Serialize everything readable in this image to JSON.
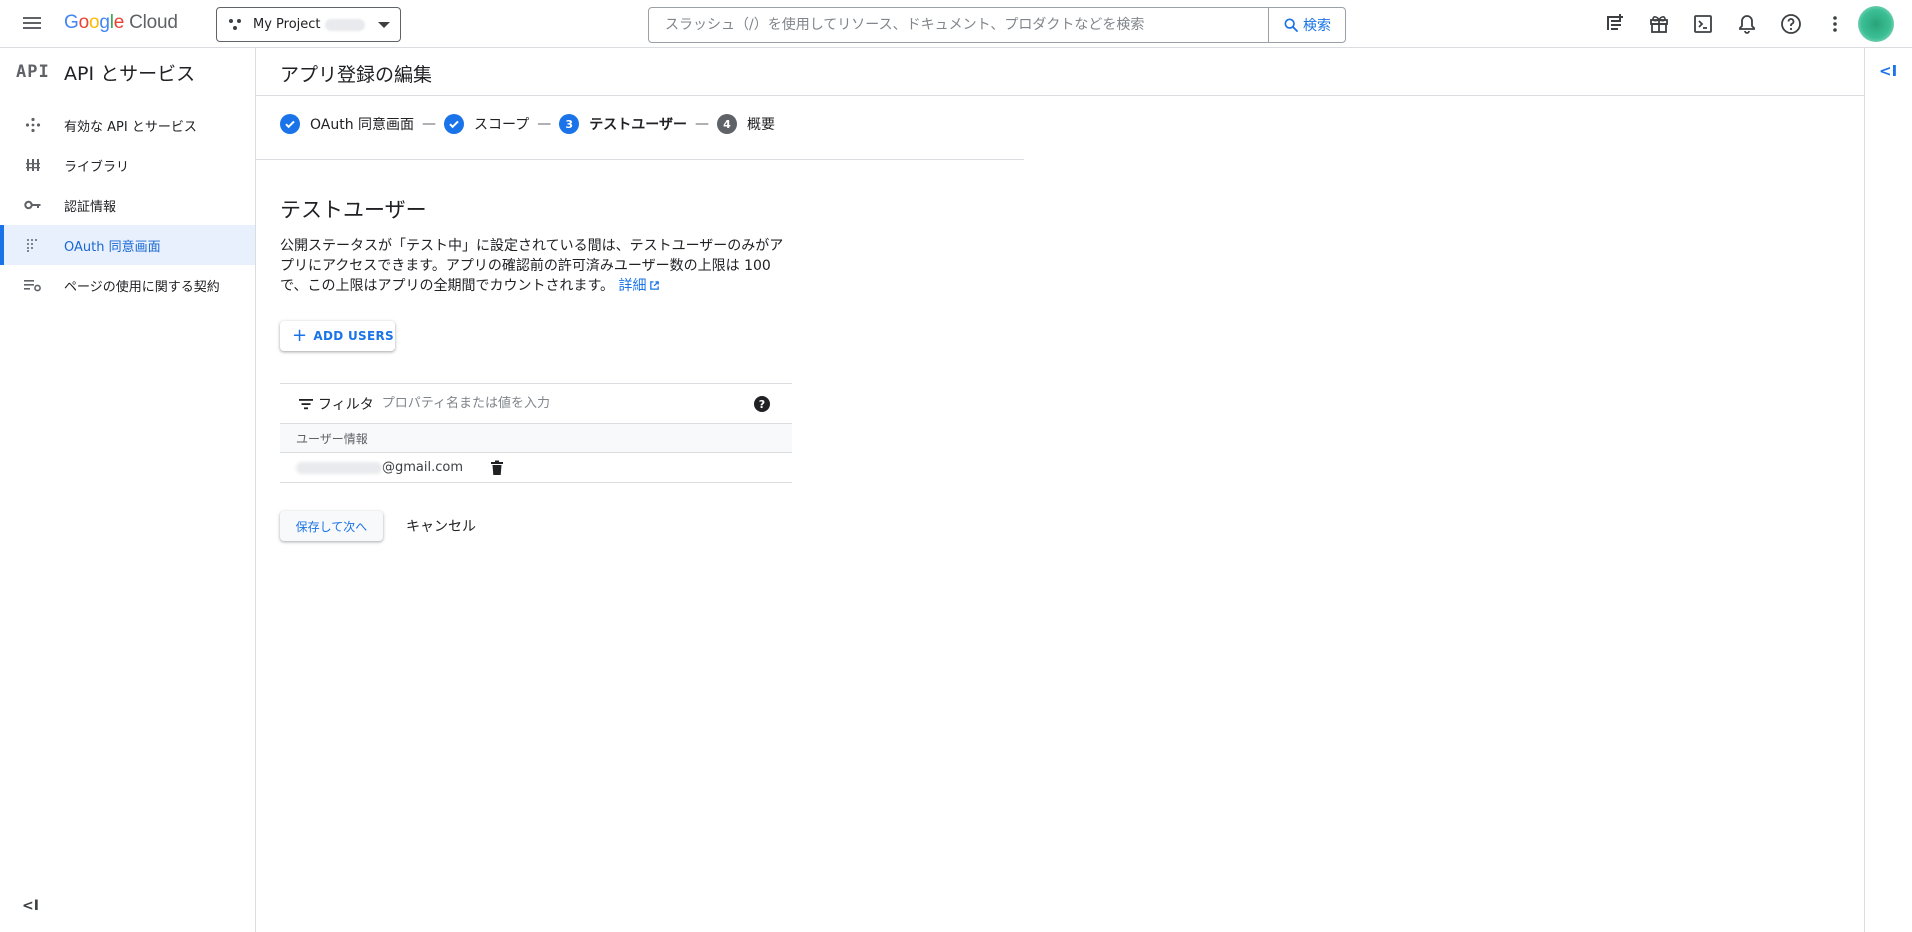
{
  "topbar": {
    "logo": "Google Cloud",
    "logo_google": "Google",
    "logo_cloud": "Cloud",
    "project_name": "My Project",
    "search_placeholder": "スラッシュ（/）を使用してリソース、ドキュメント、プロダクトなどを検索",
    "search_button": "検索",
    "icons": [
      "menu-icon",
      "feedback-icon",
      "gift-icon",
      "cloud-shell-icon",
      "bell-icon",
      "help-icon",
      "more-vert-icon",
      "avatar"
    ]
  },
  "sidebar": {
    "badge": "API",
    "title": "API とサービス",
    "items": [
      {
        "label": "有効な API とサービス",
        "icon": "apis-icon",
        "active": false
      },
      {
        "label": "ライブラリ",
        "icon": "library-icon",
        "active": false
      },
      {
        "label": "認証情報",
        "icon": "key-icon",
        "active": false
      },
      {
        "label": "OAuth 同意画面",
        "icon": "consent-icon",
        "active": true
      },
      {
        "label": "ページの使用に関する契約",
        "icon": "agreements-icon",
        "active": false
      }
    ],
    "collapse_label": "<I"
  },
  "page": {
    "title": "アプリ登録の編集",
    "steps": [
      {
        "label": "OAuth 同意画面",
        "state": "done"
      },
      {
        "label": "スコープ",
        "state": "done"
      },
      {
        "number": "3",
        "label": "テストユーザー",
        "state": "current"
      },
      {
        "number": "4",
        "label": "概要",
        "state": "future"
      }
    ],
    "step_separator": "—",
    "section_title": "テストユーザー",
    "description": "公開ステータスが「テスト中」に設定されている間は、テストユーザーのみがアプリにアクセスできます。アプリの確認前の許可済みユーザー数の上限は 100 で、この上限はアプリの全期間でカウントされます。",
    "learn_more": "詳細",
    "add_users": "ADD USERS",
    "filter_label": "フィルタ",
    "filter_placeholder": "プロパティ名または値を入力",
    "table_header": "ユーザー情報",
    "users": [
      {
        "email_domain": "@gmail.com"
      }
    ],
    "save_button": "保存して次へ",
    "cancel_button": "キャンセル"
  },
  "right_panel": {
    "collapse_label": "<I"
  },
  "colors": {
    "accent": "#1a73e8",
    "active_bg": "#e8f0fe",
    "border": "#dadce0"
  }
}
